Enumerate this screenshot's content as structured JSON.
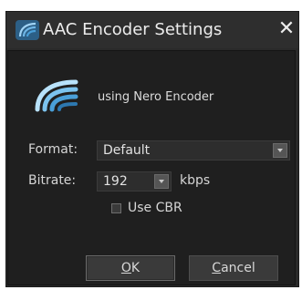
{
  "window": {
    "title": "AAC Encoder Settings",
    "close_glyph": "✕"
  },
  "header": {
    "subtitle": "using Nero Encoder",
    "icon": "nero-aac-icon"
  },
  "form": {
    "format_label": "Format:",
    "format_value": "Default",
    "bitrate_label": "Bitrate:",
    "bitrate_value": "192",
    "bitrate_unit": "kbps",
    "cbr_label": "Use CBR",
    "cbr_checked": false
  },
  "buttons": {
    "ok_mnemonic": "O",
    "ok_rest": "K",
    "cancel_mnemonic": "C",
    "cancel_rest": "ancel"
  },
  "colors": {
    "accent_icon": "#4a9fd8",
    "background": "#1f1f1f"
  }
}
